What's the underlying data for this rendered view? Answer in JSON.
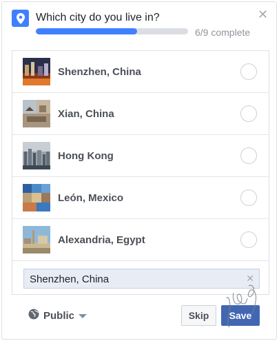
{
  "question": {
    "title": "Which city do you live in?",
    "progress_text": "6/9 complete",
    "progress_fraction": 0.667
  },
  "options": [
    {
      "label": "Shenzhen, China",
      "thumb_icon": "city-photo"
    },
    {
      "label": "Xian, China",
      "thumb_icon": "city-photo"
    },
    {
      "label": "Hong Kong",
      "thumb_icon": "city-photo"
    },
    {
      "label": "León, Mexico",
      "thumb_icon": "city-photo"
    },
    {
      "label": "Alexandria, Egypt",
      "thumb_icon": "city-photo"
    }
  ],
  "selected": {
    "value": "Shenzhen, China"
  },
  "footer": {
    "privacy_label": "Public",
    "skip_label": "Skip",
    "save_label": "Save"
  },
  "colors": {
    "accent": "#4080ff",
    "save_button": "#4267b2"
  }
}
